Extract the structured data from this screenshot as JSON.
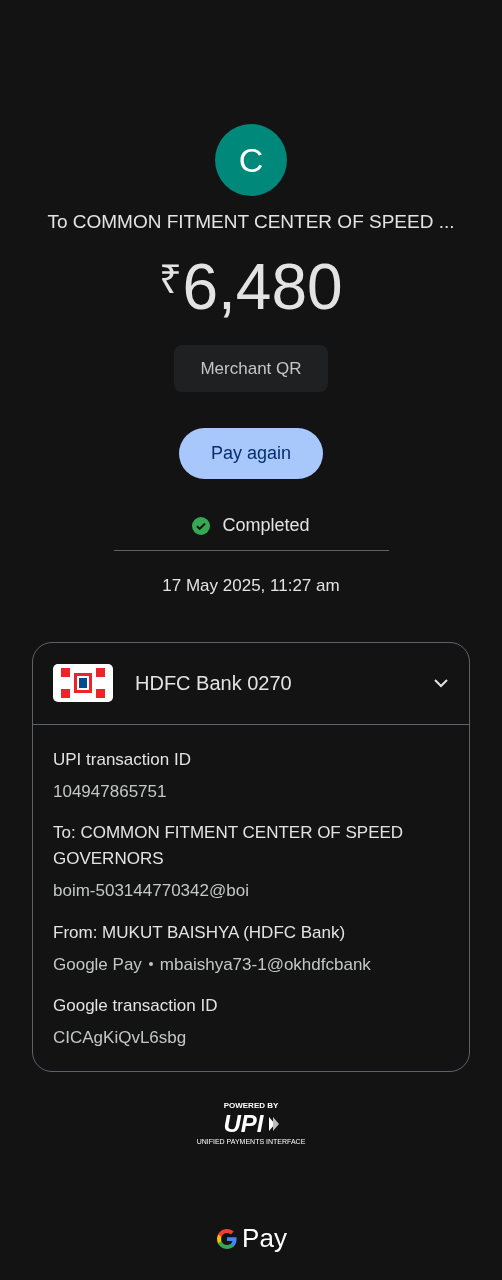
{
  "avatar": {
    "initial": "C",
    "color": "#00897b"
  },
  "recipient": "To COMMON FITMENT CENTER OF SPEED ...",
  "amount": {
    "currency": "₹",
    "value": "6,480"
  },
  "tag": "Merchant QR",
  "action_button": "Pay again",
  "status": "Completed",
  "date": "17 May 2025, 11:27 am",
  "account_card": {
    "bank": "HDFC Bank 0270",
    "expanded": true,
    "details": [
      {
        "label": "UPI transaction ID",
        "values": [
          "104947865751"
        ]
      },
      {
        "label": "To: COMMON FITMENT CENTER OF SPEED GOVERNORS",
        "values": [
          "boim-503144770342@boi"
        ]
      },
      {
        "label": "From: MUKUT BAISHYA (HDFC Bank)",
        "values": [
          "Google Pay",
          "mbaishya73-1@okhdfcbank"
        ]
      },
      {
        "label": "Google transaction ID",
        "values": [
          "CICAgKiQvL6sbg"
        ]
      }
    ]
  },
  "upi_badge": {
    "powered_by": "POWERED BY",
    "logo": "UPI",
    "tagline": "UNIFIED PAYMENTS INTERFACE"
  },
  "footer_brand": "Pay"
}
